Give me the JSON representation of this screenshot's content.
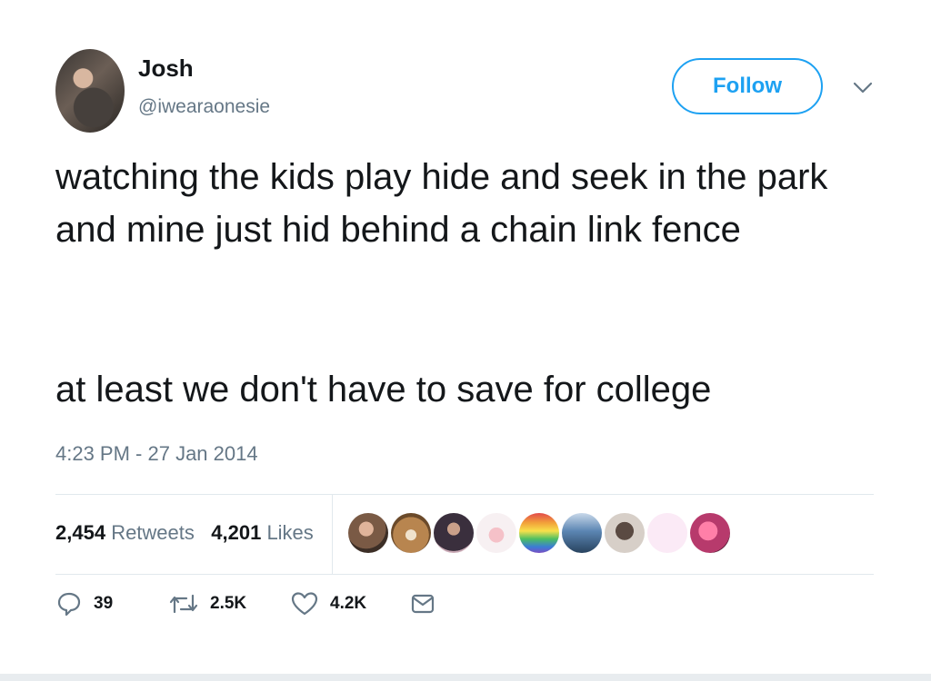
{
  "tweet": {
    "user": {
      "name": "Josh",
      "handle": "@iwearaonesie"
    },
    "follow_label": "Follow",
    "text_p1": "watching the kids play hide and seek in the park and mine just hid behind a chain link fence",
    "text_p2": "at least we don't have to save for college",
    "timestamp": "4:23 PM - 27 Jan 2014",
    "stats": {
      "retweets_count": "2,454",
      "retweets_label": "Retweets",
      "likes_count": "4,201",
      "likes_label": "Likes"
    },
    "liker_avatars": 10,
    "actions": {
      "reply_count": "39",
      "retweet_count": "2.5K",
      "like_count": "4.2K"
    }
  },
  "colors": {
    "accent": "#1da1f2",
    "secondary": "#657786",
    "text": "#14171a",
    "divider": "#e1e8ed"
  }
}
